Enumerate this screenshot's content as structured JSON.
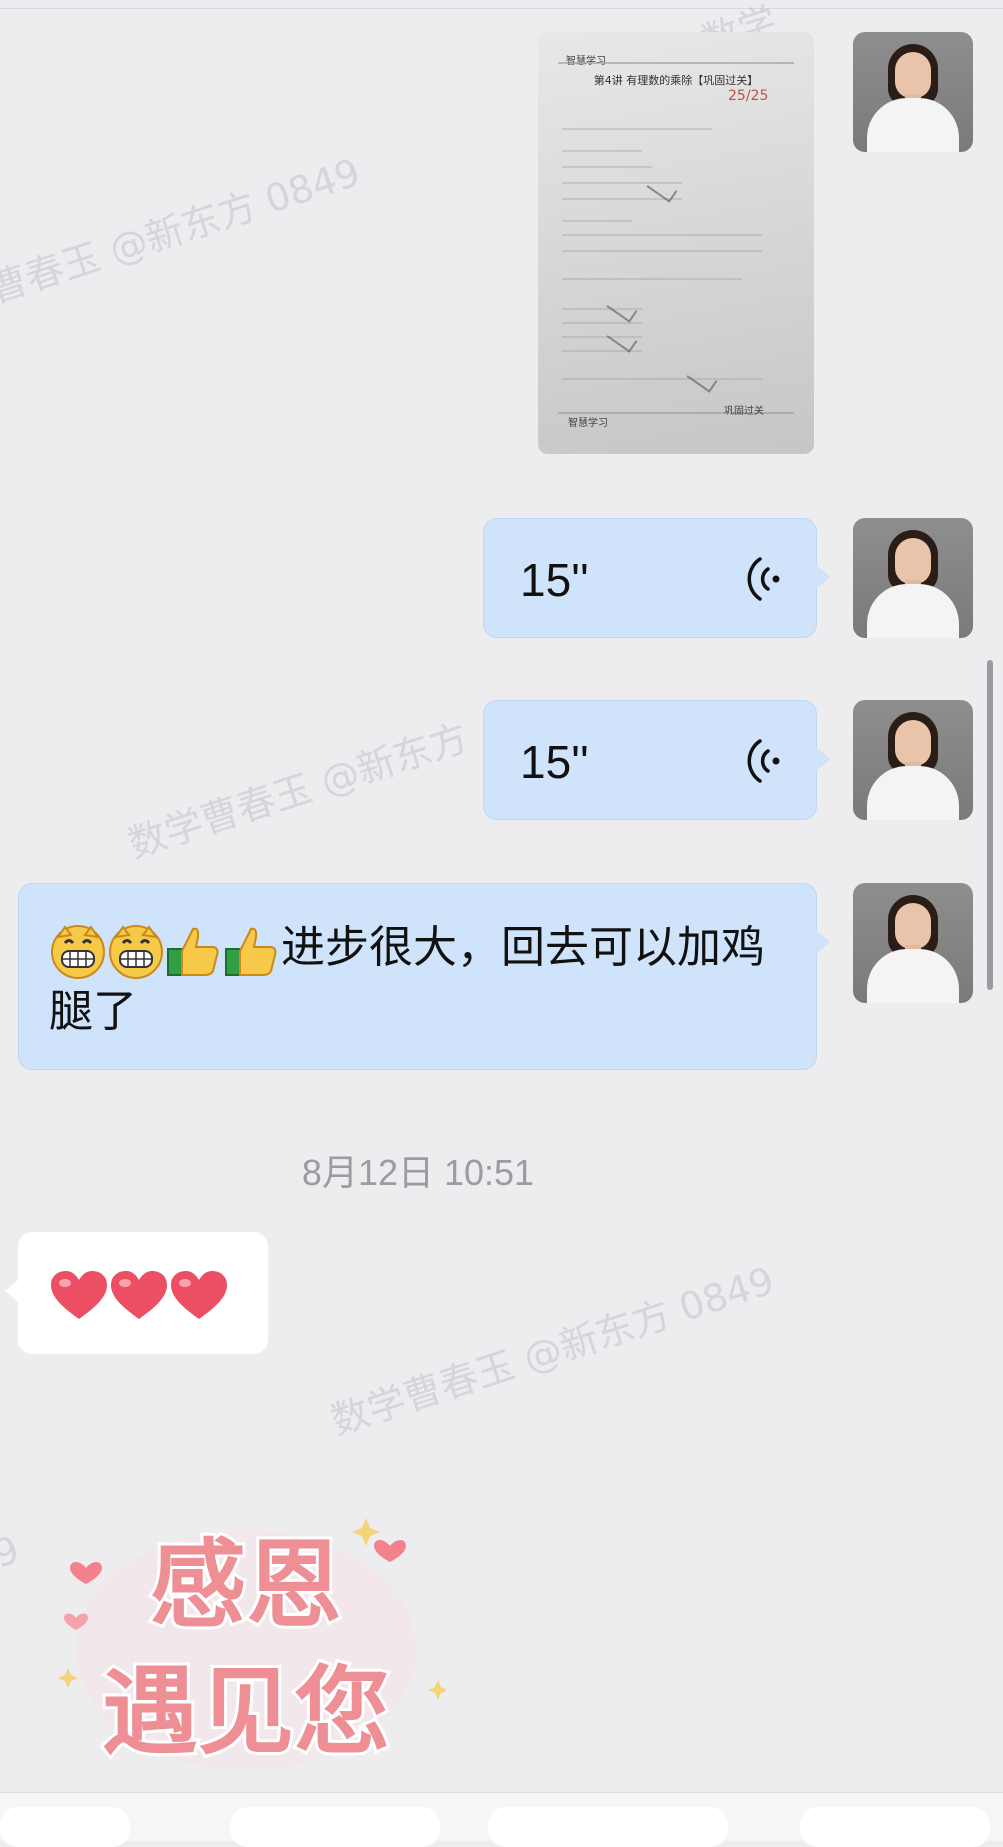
{
  "watermarks": [
    "曹春玉 @新东方 0849",
    "数学曹春玉 @新东方",
    "数学曹春玉 @新东方 0849",
    "数学",
    "9"
  ],
  "photo_message": {
    "logo": "智慧学习",
    "sheet_title": "第4讲 有理数的乘除【巩固过关】",
    "score": "25/25",
    "corner_note": "巩固过关"
  },
  "voice_messages": [
    {
      "duration": "15''",
      "icon": "voice-wave-icon"
    },
    {
      "duration": "15''",
      "icon": "voice-wave-icon"
    }
  ],
  "text_message": {
    "text": "进步很大，回去可以加鸡腿了",
    "emojis": [
      "grinning-emoji",
      "grinning-emoji",
      "thumbs-up-emoji",
      "thumbs-up-emoji"
    ]
  },
  "timestamp": "8月12日 10:51",
  "reply_message": {
    "emojis": [
      "heart-emoji",
      "heart-emoji",
      "heart-emoji"
    ]
  },
  "sticker": {
    "line1": "感恩",
    "line2": "遇见您"
  },
  "colors": {
    "background": "#ededf0",
    "outgoing_bubble": "#cfe3fb",
    "incoming_bubble": "#ffffff",
    "timestamp_text": "#9b9ba0",
    "sticker_pink": "#ee8f95"
  }
}
